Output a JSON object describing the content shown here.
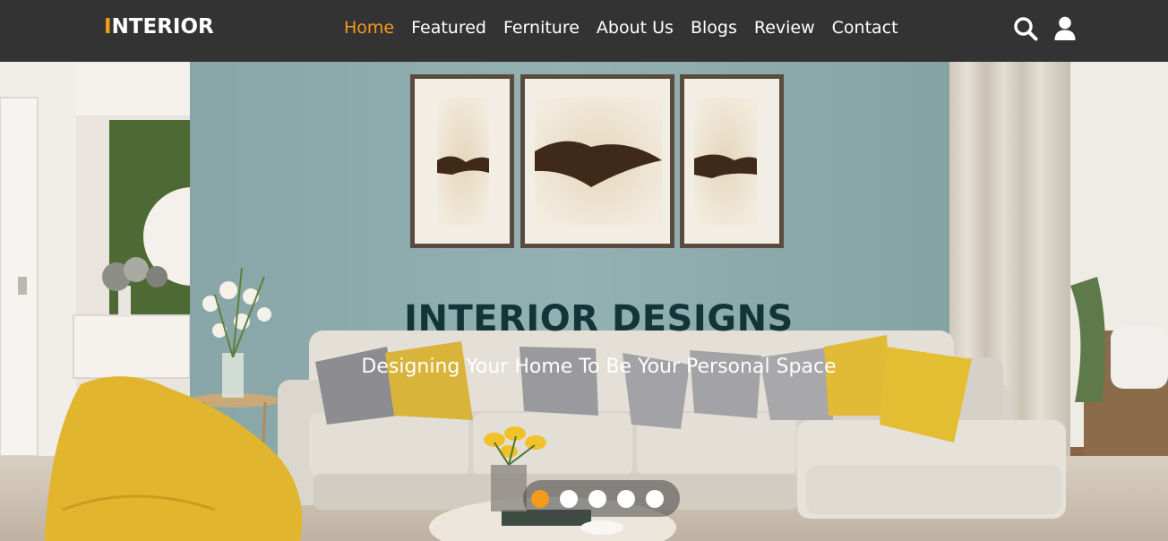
{
  "logo": {
    "first_letter": "I",
    "rest": "NTERIOR"
  },
  "nav": {
    "items": [
      {
        "label": "Home",
        "active": true
      },
      {
        "label": "Featured"
      },
      {
        "label": "Ferniture"
      },
      {
        "label": "About Us"
      },
      {
        "label": "Blogs"
      },
      {
        "label": "Review"
      },
      {
        "label": "Contact"
      }
    ],
    "icons": [
      "search-icon",
      "user-icon"
    ]
  },
  "hero": {
    "title": "INTERIOR DESIGNS",
    "subtitle": "Designing Your Home To Be Your Personal Space"
  },
  "slider": {
    "count": 5,
    "active_index": 0
  },
  "colors": {
    "accent": "#f59b1b",
    "navbar": "#333333",
    "title": "#123638",
    "wall": "#8fadae"
  }
}
